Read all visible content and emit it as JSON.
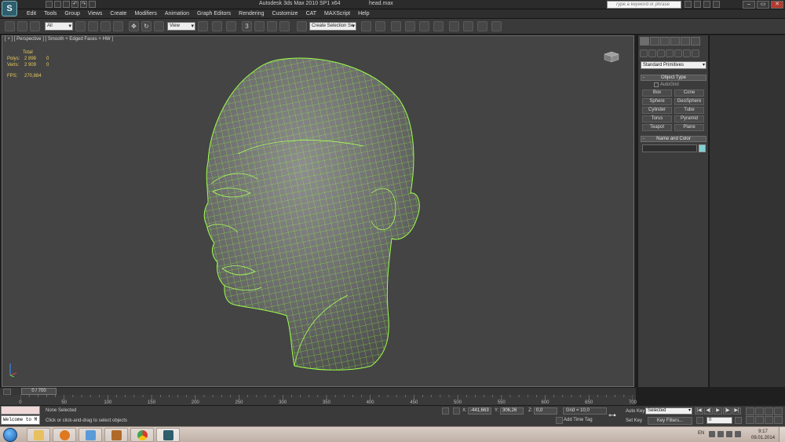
{
  "titlebar": {
    "app_title": "Autodesk 3ds Max  2010 SP1 x64",
    "file_name": "head.max",
    "help_search_placeholder": "Type a keyword or phrase",
    "window_minimize": "–",
    "window_maximize": "▭",
    "window_close": "✕"
  },
  "menu": [
    "Edit",
    "Tools",
    "Group",
    "Views",
    "Create",
    "Modifiers",
    "Animation",
    "Graph Editors",
    "Rendering",
    "Customize",
    "CAT",
    "MAXScript",
    "Help"
  ],
  "toolbar": {
    "selection_filter": "All",
    "reference_coord": "View",
    "named_selection": "Create Selection Se",
    "snap_label": "3"
  },
  "viewport": {
    "label": "[ + ] [ Perspective ] [ Smooth + Edged Faces + HW ]",
    "stats": {
      "header": "Total",
      "polys_label": "Polys:",
      "polys_total": "2 898",
      "polys_sel": "0",
      "verts_label": "Verts:",
      "verts_total": "2 909",
      "verts_sel": "0",
      "fps_label": "FPS:",
      "fps_value": "270,884"
    }
  },
  "command_panel": {
    "category": "Standard Primitives",
    "object_type_header": "Object Type",
    "autogrid": "AutoGrid",
    "objects": [
      "Box",
      "Cone",
      "Sphere",
      "GeoSphere",
      "Cylinder",
      "Tube",
      "Torus",
      "Pyramid",
      "Teapot",
      "Plane"
    ],
    "name_color_header": "Name and Color",
    "rollout_toggle": "-",
    "swatch_color": "#7fd1d6"
  },
  "timeline": {
    "slider_label": "0 / 700",
    "ticks": [
      "0",
      "50",
      "100",
      "150",
      "200",
      "250",
      "300",
      "350",
      "400",
      "450",
      "500",
      "550",
      "600",
      "650",
      "700"
    ]
  },
  "status": {
    "maxscript_output": "Welcome to M",
    "selection": "None Selected",
    "prompt": "Click or click-and-drag to select objects",
    "x_label": "X:",
    "x_value": "-441,663",
    "y_label": "Y:",
    "y_value": "306,26",
    "z_label": "Z:",
    "z_value": "0,0",
    "grid": "Grid = 10,0",
    "add_time_tag": "Add Time Tag",
    "auto_key": "Auto Key",
    "set_key": "Set Key",
    "key_mode": "Selected",
    "key_filters": "Key Filters...",
    "current_frame": "0",
    "playback": [
      "|◀",
      "◀|",
      "▶",
      "|▶",
      "▶|"
    ]
  },
  "taskbar": {
    "language": "EN",
    "time": "9:17",
    "date": "09.01.2014",
    "apps": [
      "explorer-icon",
      "media-player-icon",
      "paint-icon",
      "archive-icon",
      "chrome-icon",
      "3dsmax-icon"
    ]
  }
}
